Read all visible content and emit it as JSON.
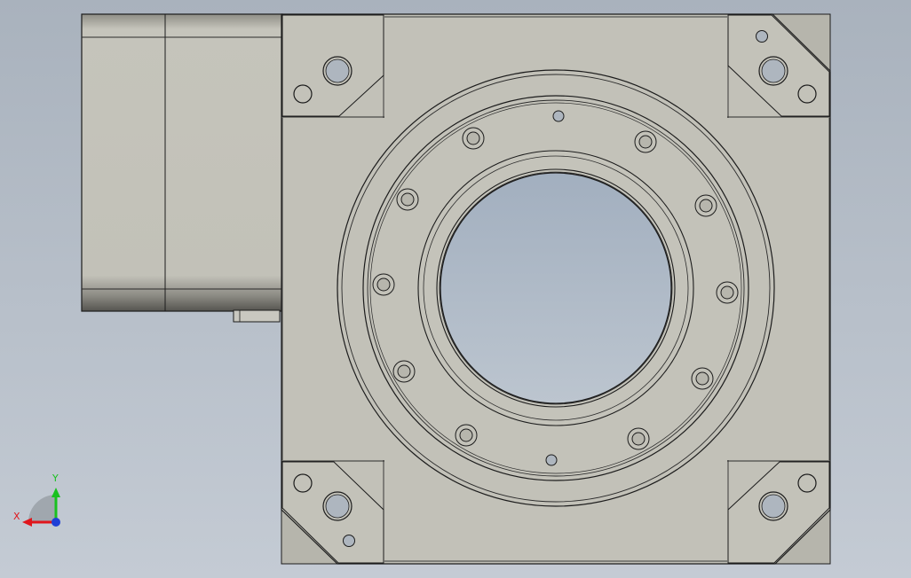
{
  "viewport": {
    "background_top": "#a9b2bd",
    "background_bottom": "#c4cbd4"
  },
  "colors": {
    "part_face": "#c2c1b8",
    "part_face_dark": "#b4b3aa",
    "edge_line": "#1c1c1c",
    "bore_top": "#a2afbf",
    "bore_bottom": "#bcc5cf",
    "axis_x": "#e0161c",
    "axis_y": "#19c11f",
    "axis_z": "#1f3fd6"
  },
  "triad": {
    "x_label": "X",
    "y_label": "Y"
  }
}
